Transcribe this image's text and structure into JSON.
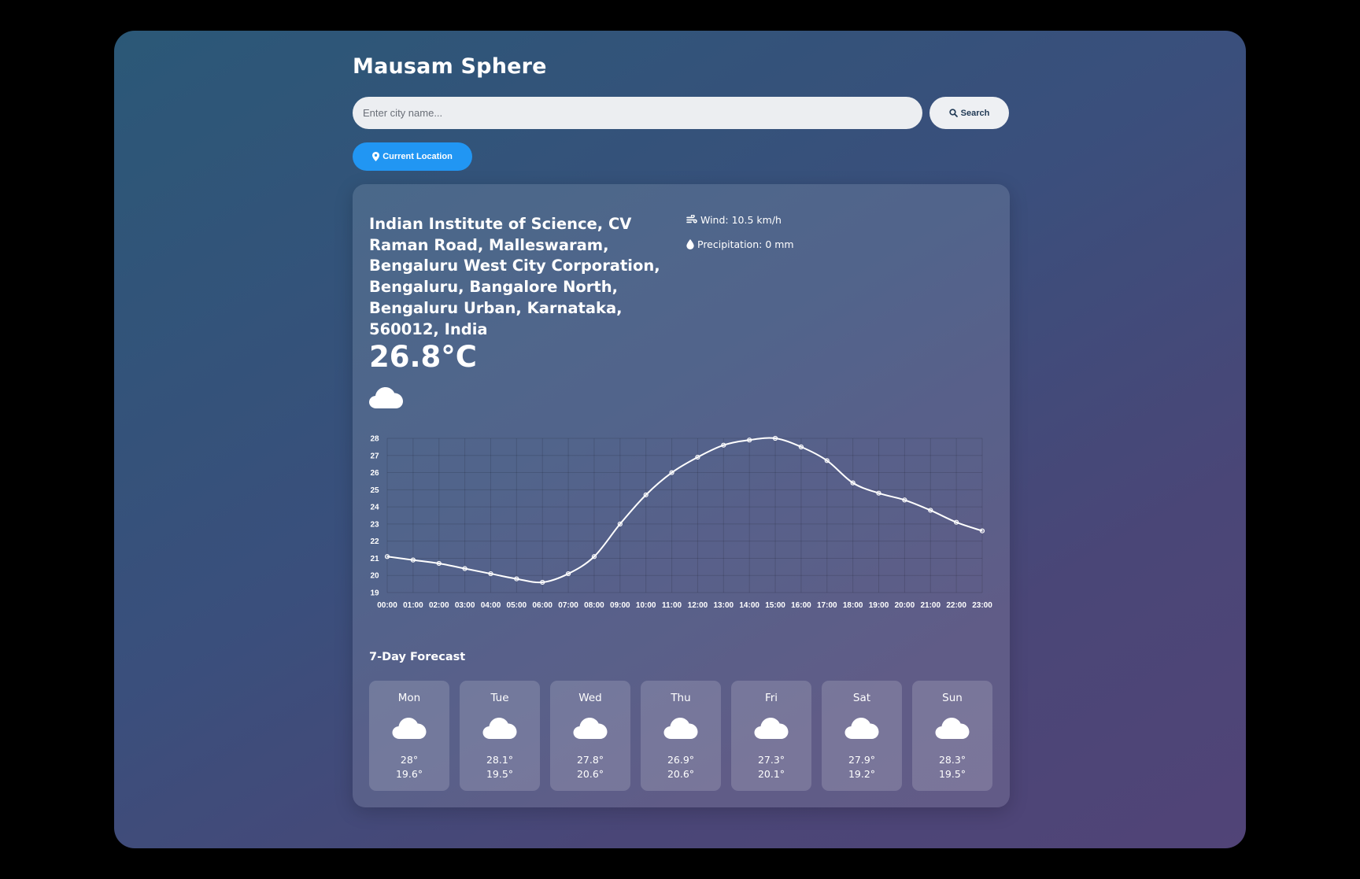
{
  "app": {
    "title": "Mausam Sphere"
  },
  "search": {
    "placeholder": "Enter city name...",
    "value": "",
    "button_label": "Search"
  },
  "location_button": {
    "label": "Current Location"
  },
  "current": {
    "location": "Indian Institute of Science, CV Raman Road, Malleswaram, Bengaluru West City Corporation, Bengaluru, Bangalore North, Bengaluru Urban, Karnataka, 560012, India",
    "temperature": "26.8°C",
    "wind": "Wind: 10.5 km/h",
    "precipitation": "Precipitation: 0 mm",
    "icon": "cloud-icon"
  },
  "chart_data": {
    "type": "line",
    "x": [
      "00:00",
      "01:00",
      "02:00",
      "03:00",
      "04:00",
      "05:00",
      "06:00",
      "07:00",
      "08:00",
      "09:00",
      "10:00",
      "11:00",
      "12:00",
      "13:00",
      "14:00",
      "15:00",
      "16:00",
      "17:00",
      "18:00",
      "19:00",
      "20:00",
      "21:00",
      "22:00",
      "23:00"
    ],
    "series": [
      {
        "values": [
          21.1,
          20.9,
          20.7,
          20.4,
          20.1,
          19.8,
          19.6,
          20.1,
          21.1,
          23.0,
          24.7,
          26.0,
          26.9,
          27.6,
          27.9,
          28.0,
          27.5,
          26.7,
          25.4,
          24.8,
          24.4,
          23.8,
          23.1,
          22.6
        ],
        "color": "#ffffff"
      }
    ],
    "y_ticks": [
      19,
      20,
      21,
      22,
      23,
      24,
      25,
      26,
      27,
      28
    ],
    "ylim": [
      19,
      28
    ],
    "grid": true,
    "legend": "none"
  },
  "forecast": {
    "title": "7-Day Forecast",
    "days": [
      {
        "day": "Mon",
        "high": "28°",
        "low": "19.6°",
        "icon": "cloud-icon"
      },
      {
        "day": "Tue",
        "high": "28.1°",
        "low": "19.5°",
        "icon": "cloud-icon"
      },
      {
        "day": "Wed",
        "high": "27.8°",
        "low": "20.6°",
        "icon": "cloud-icon"
      },
      {
        "day": "Thu",
        "high": "26.9°",
        "low": "20.6°",
        "icon": "cloud-icon"
      },
      {
        "day": "Fri",
        "high": "27.3°",
        "low": "20.1°",
        "icon": "cloud-icon"
      },
      {
        "day": "Sat",
        "high": "27.9°",
        "low": "19.2°",
        "icon": "cloud-icon"
      },
      {
        "day": "Sun",
        "high": "28.3°",
        "low": "19.5°",
        "icon": "cloud-icon"
      }
    ]
  }
}
